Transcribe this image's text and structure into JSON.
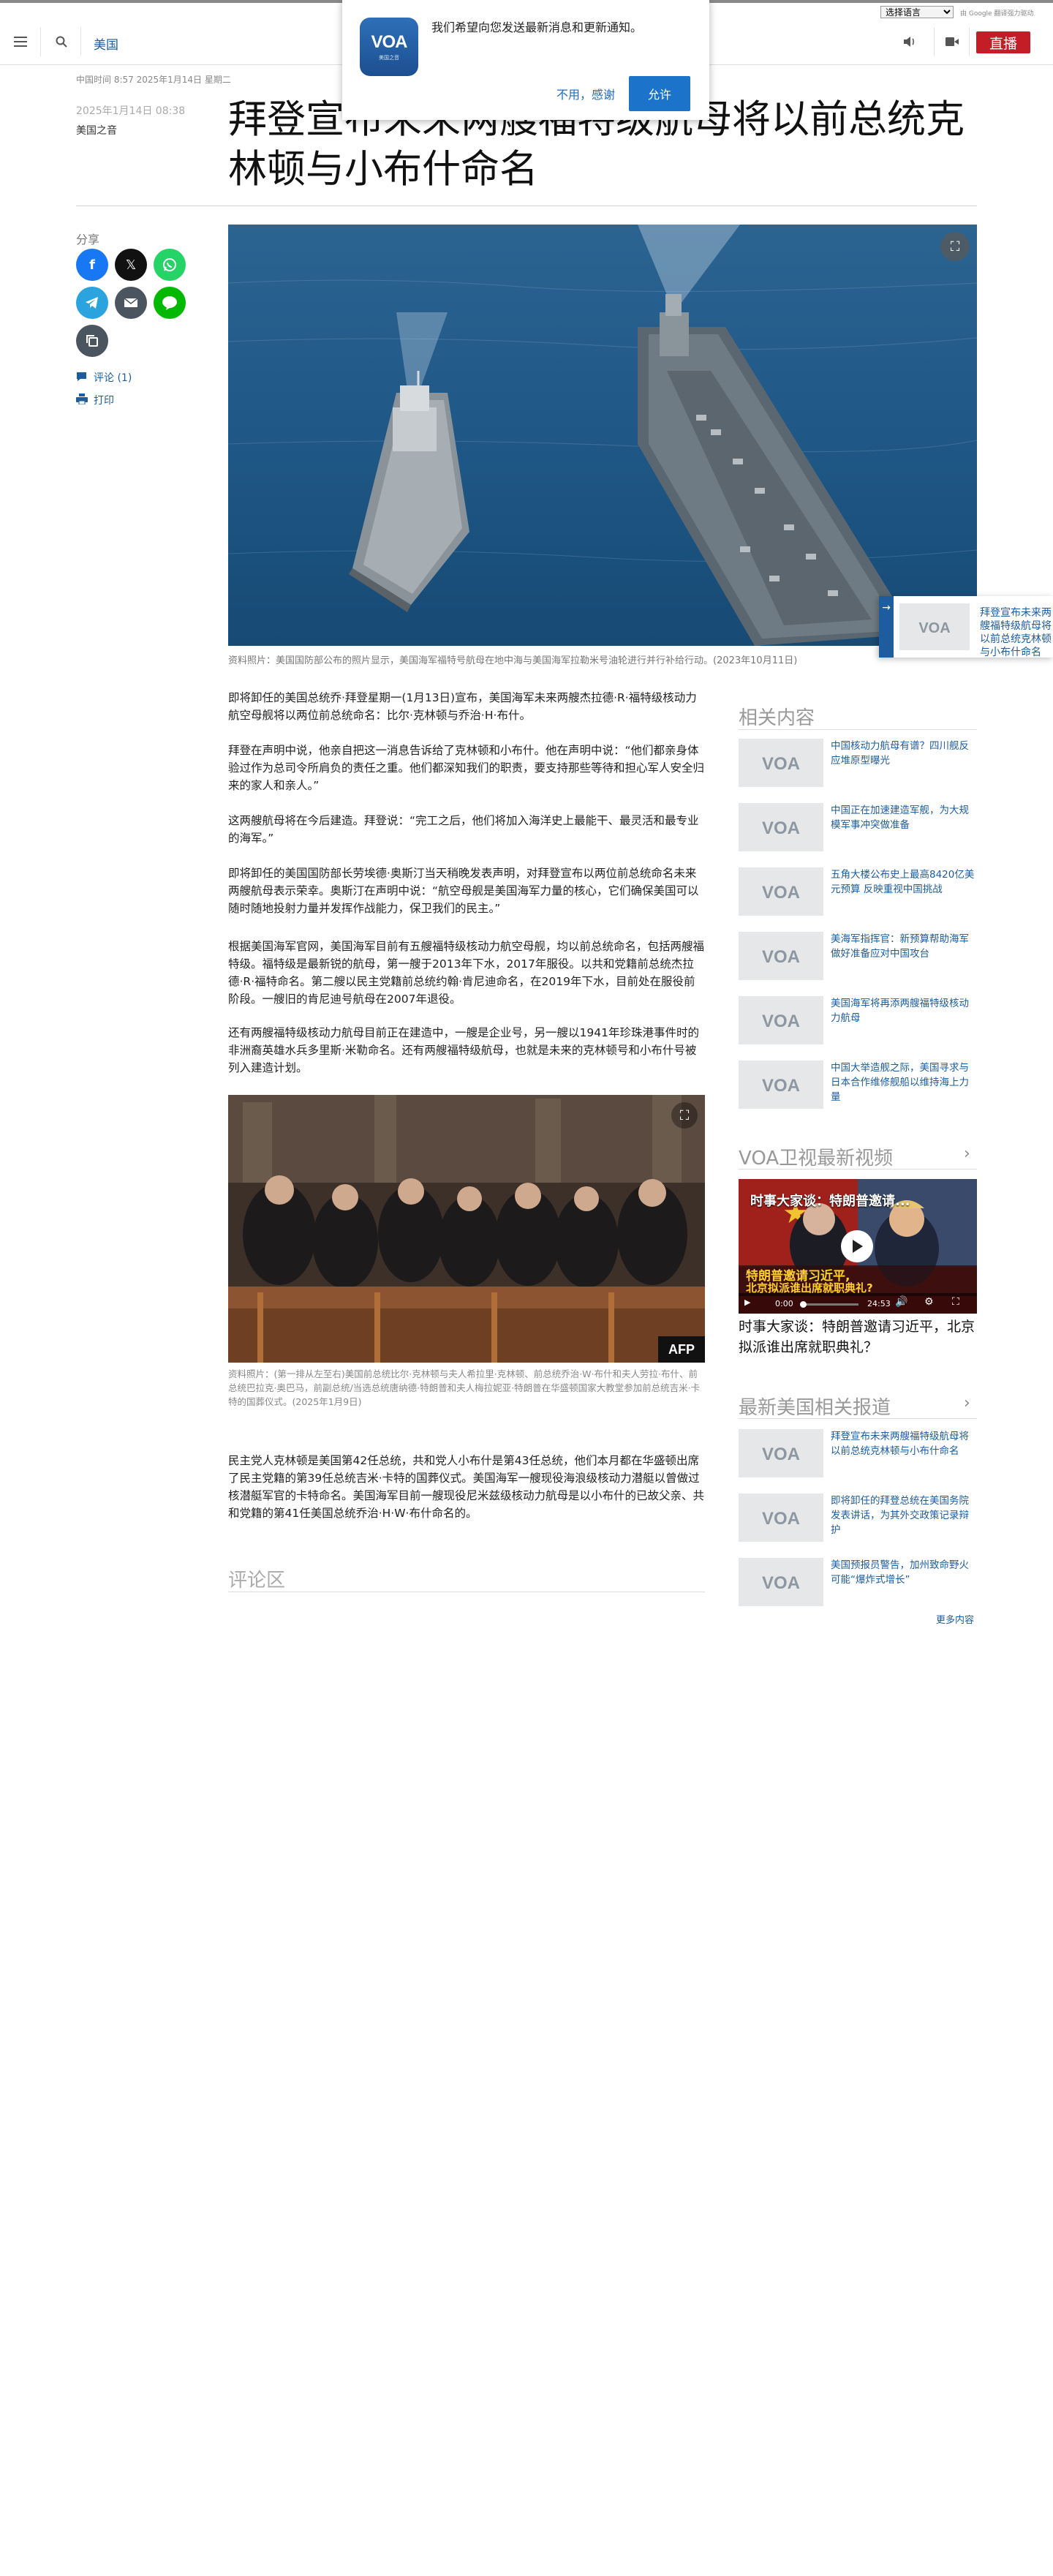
{
  "language_bar": {
    "select_label": "选择语言",
    "credit": "由 Google 翻译强力驱动"
  },
  "header": {
    "section": "美国",
    "live_label": "直播"
  },
  "notification": {
    "logo_text": "VOA",
    "logo_sub": "美国之音",
    "message": "我们希望向您发送最新消息和更新通知。",
    "cancel_label": "不用，感谢",
    "allow_label": "允许"
  },
  "timestamp_bar": "中国时间 8:57 2025年1月14日 星期二",
  "article": {
    "date": "2025年1月14日 08:38",
    "author": "美国之音",
    "headline": "拜登宣布未来两艘福特级航母将以前总统克林顿与小布什命名",
    "hero_caption": "资料照片：美国国防部公布的照片显示，美国海军福特号航母在地中海与美国海军拉勒米号油轮进行并行补给行动。(2023年10月11日)",
    "paragraphs": [
      "即将卸任的美国总统乔·拜登星期一(1月13日)宣布，美国海军未来两艘杰拉德·R·福特级核动力航空母舰将以两位前总统命名：比尔·克林顿与乔治·H·布什。",
      "拜登在声明中说，他亲自把这一消息告诉给了克林顿和小布什。他在声明中说：“他们都亲身体验过作为总司令所肩负的责任之重。他们都深知我们的职责，要支持那些等待和担心军人安全归来的家人和亲人。”",
      "这两艘航母将在今后建造。拜登说：“完工之后，他们将加入海洋史上最能干、最灵活和最专业的海军。”",
      "即将卸任的美国国防部长劳埃德·奥斯汀当天稍晚发表声明，对拜登宣布以两位前总统命名未来两艘航母表示荣幸。奥斯汀在声明中说：“航空母舰是美国海军力量的核心，它们确保美国可以随时随地投射力量并发挥作战能力，保卫我们的民主。”",
      "根据美国海军官网，美国海军目前有五艘福特级核动力航空母舰，均以前总统命名，包括两艘福特级。福特级是最新锐的航母，第一艘于2013年下水，2017年服役。以共和党籍前总统杰拉德·R·福特命名。第二艘以民主党籍前总统约翰·肯尼迪命名，在2019年下水，目前处在服役前阶段。一艘旧的肯尼迪号航母在2007年退役。",
      "还有两艘福特级核动力航母目前正在建造中，一艘是企业号，另一艘以1941年珍珠港事件时的非洲裔英雄水兵多里斯·米勒命名。还有两艘福特级航母，也就是未来的克林顿号和小布什号被列入建造计划。"
    ],
    "photo2_caption": "资料照片：(第一排从左至右)美国前总统比尔·克林顿与夫人希拉里·克林顿、前总统乔治·W·布什和夫人劳拉·布什、前总统巴拉克·奥巴马，前副总统/当选总统唐纳德·特朗普和夫人梅拉妮亚·特朗普在华盛顿国家大教堂参加前总统吉米·卡特的国葬仪式。(2025年1月9日)",
    "photo2_credit": "AFP",
    "closing_paragraph": "民主党人克林顿是美国第42任总统，共和党人小布什是第43任总统，他们本月都在华盛顿出席了民主党籍的第39任总统吉米·卡特的国葬仪式。美国海军一艘现役海浪级核动力潜艇以曾做过核潜艇军官的卡特命名。美国海军目前一艘现役尼米兹级核动力航母是以小布什的已故父亲、共和党籍的第41任美国总统乔治·H·W·布什命名的。",
    "comments_heading": "评论区"
  },
  "share": {
    "label": "分享",
    "comments_link": "评论 (1)",
    "print_link": "打印",
    "colors": {
      "facebook": "#1877f2",
      "x": "#111111",
      "whatsapp": "#25d366",
      "telegram": "#2aa3df",
      "email": "#4b5560",
      "line": "#00b900",
      "copy": "#4b5560"
    }
  },
  "floating_player": {
    "title": "拜登宣布未来两艘福特级航母将以前总统克林顿与小布什命名"
  },
  "sidebar": {
    "related_heading": "相关内容",
    "related": [
      "中国核动力航母有谱？四川舰反应堆原型曝光",
      "中国正在加速建造军舰，为大规模军事冲突做准备",
      "五角大楼公布史上最高8420亿美元预算 反映重视中国挑战",
      "美海军指挥官：新预算帮助海军做好准备应对中国攻台",
      "美国海军将再添两艘福特级核动力航母",
      "中国大举造舰之际，美国寻求与日本合作维修舰船以维持海上力量"
    ],
    "video_heading": "VOA卫视最新视频",
    "video": {
      "overlay_title": "时事大家谈：特朗普邀请...",
      "overlay_banner_line1": "特朗普邀请习近平,",
      "overlay_banner_line2": "北京拟派谁出席就职典礼?",
      "time_current": "0:00",
      "time_total": "24:53",
      "title": "时事大家谈：特朗普邀请习近平，北京拟派谁出席就职典礼？"
    },
    "latest_heading": "最新美国相关报道",
    "latest": [
      "拜登宣布未来两艘福特级航母将以前总统克林顿与小布什命名",
      "即将卸任的拜登总统在美国务院发表讲话，为其外交政策记录辩护",
      "美国预报员警告，加州致命野火可能“爆炸式增长”"
    ],
    "more_label": "更多内容"
  }
}
